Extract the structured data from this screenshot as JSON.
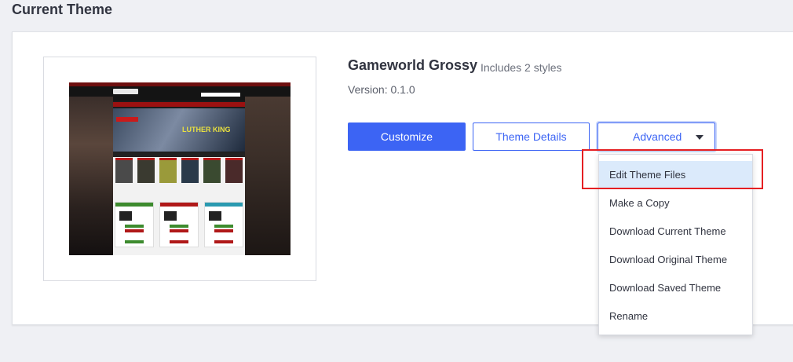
{
  "page": {
    "title": "Current Theme"
  },
  "theme": {
    "name": "Gameworld Grossy",
    "styles": "Includes 2 styles",
    "version": "Version: 0.1.0",
    "thumbnail_banner_text": "LUTHER KING"
  },
  "actions": {
    "customize": "Customize",
    "details": "Theme Details",
    "advanced": "Advanced"
  },
  "advanced_menu": {
    "items": [
      {
        "label": "Edit Theme Files",
        "active": true
      },
      {
        "label": "Make a Copy"
      },
      {
        "label": "Download Current Theme"
      },
      {
        "label": "Download Original Theme"
      },
      {
        "label": "Download Saved Theme"
      },
      {
        "label": "Rename"
      }
    ]
  },
  "colors": {
    "primary": "#3c64f4",
    "active_item_bg": "#dbeafb",
    "highlight": "#e51f22"
  },
  "icons": {
    "dropdown": "caret-down-icon"
  }
}
